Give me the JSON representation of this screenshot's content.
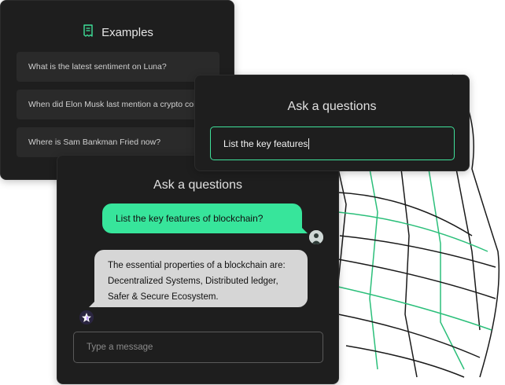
{
  "examples": {
    "title": "Examples",
    "icon": "receipt-icon",
    "items": [
      "What is the latest sentiment on Luna?",
      "When did Elon Musk last mention a crypto coin?",
      "Where is Sam Bankman Fried now?"
    ]
  },
  "ask_top": {
    "title": "Ask a questions",
    "input_value": "List the key features"
  },
  "chat": {
    "title": "Ask a questions",
    "user_message": "List the key features of blockchain?",
    "bot_message": "The essential properties of a blockchain are: Decentralized Systems, Distributed ledger, Safer & Secure Ecosystem.",
    "input_placeholder": "Type a message"
  },
  "colors": {
    "accent": "#37e59b",
    "card_bg": "#1e1e1e",
    "item_bg": "#2a2a2a",
    "bot_bubble": "#d6d6d6"
  }
}
